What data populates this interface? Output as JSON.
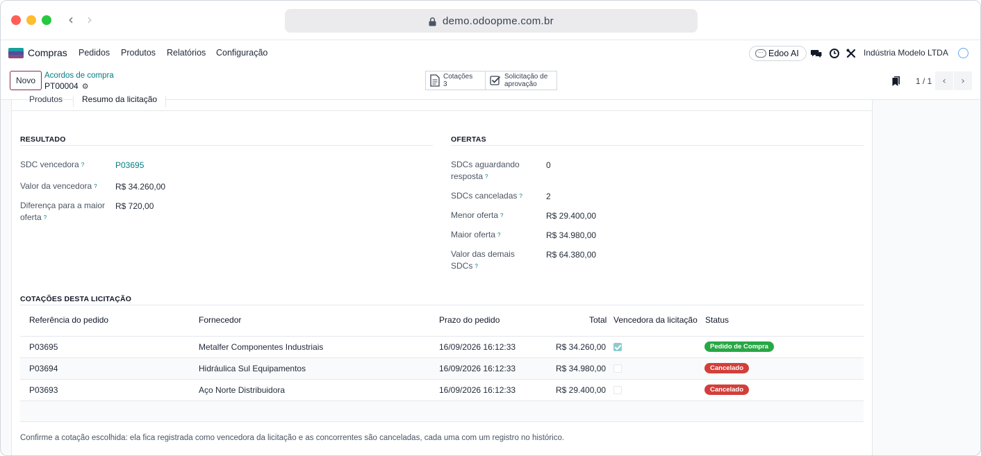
{
  "browser": {
    "url": "demo.odoopme.com.br"
  },
  "topnav": {
    "app_name": "Compras",
    "menu": [
      "Pedidos",
      "Produtos",
      "Relatórios",
      "Configuração"
    ],
    "ai_label": "Edoo AI",
    "company": "Indústria Modelo LTDA",
    "icons": [
      "chat-icon",
      "clock-icon",
      "tools-icon",
      "avatar"
    ]
  },
  "controlpanel": {
    "new_label": "Novo",
    "breadcrumb_parent": "Acordos de compra",
    "breadcrumb_current": "PT00004",
    "smart_buttons": [
      {
        "line1": "Cotações",
        "line2": "3",
        "icon": "document-icon"
      },
      {
        "line1": "Solicitação de",
        "line2": "aprovação",
        "icon": "checkbox-icon"
      }
    ],
    "pager": "1 / 1"
  },
  "tabs": [
    "Produtos",
    "Resumo da licitação"
  ],
  "resultado": {
    "title": "RESULTADO",
    "fields": [
      {
        "label": "SDC vencedora",
        "help": "?",
        "value": "P03695"
      },
      {
        "label": "Valor da vencedora",
        "help": "?",
        "value": "R$ 34.260,00"
      },
      {
        "label_line1": "Diferença para a maior",
        "label_line2": "oferta",
        "help": "?",
        "value": "R$ 720,00"
      }
    ]
  },
  "ofertas": {
    "title": "OFERTAS",
    "fields": [
      {
        "label_line1": "SDCs aguardando",
        "label_line2": "resposta",
        "help": "?",
        "value": "0"
      },
      {
        "label": "SDCs canceladas",
        "help": "?",
        "value": "2"
      },
      {
        "label": "Menor oferta",
        "help": "?",
        "value": "R$ 29.400,00"
      },
      {
        "label": "Maior oferta",
        "help": "?",
        "value": "R$ 34.980,00"
      },
      {
        "label_line1": "Valor das demais",
        "label_line2": "SDCs",
        "help": "?",
        "value": "R$ 64.380,00"
      }
    ]
  },
  "cotacoes": {
    "title": "COTAÇÕES DESTA LICITAÇÃO",
    "columns": [
      "Referência do pedido",
      "Fornecedor",
      "Prazo do pedido",
      "Total",
      "Vencedora da licitação",
      "Status"
    ],
    "rows": [
      {
        "ref": "P03695",
        "supplier": "Metalfer Componentes Industriais",
        "deadline": "16/09/2026 16:12:33",
        "total": "R$ 34.260,00",
        "winner": true,
        "status": "Pedido de Compra",
        "status_kind": "success"
      },
      {
        "ref": "P03694",
        "supplier": "Hidráulica Sul Equipamentos",
        "deadline": "16/09/2026 16:12:33",
        "total": "R$ 34.980,00",
        "winner": false,
        "status": "Cancelado",
        "status_kind": "danger"
      },
      {
        "ref": "P03693",
        "supplier": "Aço Norte Distribuidora",
        "deadline": "16/09/2026 16:12:33",
        "total": "R$ 29.400,00",
        "winner": false,
        "status": "Cancelado",
        "status_kind": "danger"
      }
    ]
  },
  "help_text": "Confirme a cotação escolhida: ela fica registrada como vencedora da licitação e as concorrentes são canceladas, cada uma com um registro no histórico.",
  "colors": {
    "accent": "#017e84",
    "brand": "#7c2d4e",
    "success": "#28a745",
    "danger": "#d23f3a"
  }
}
